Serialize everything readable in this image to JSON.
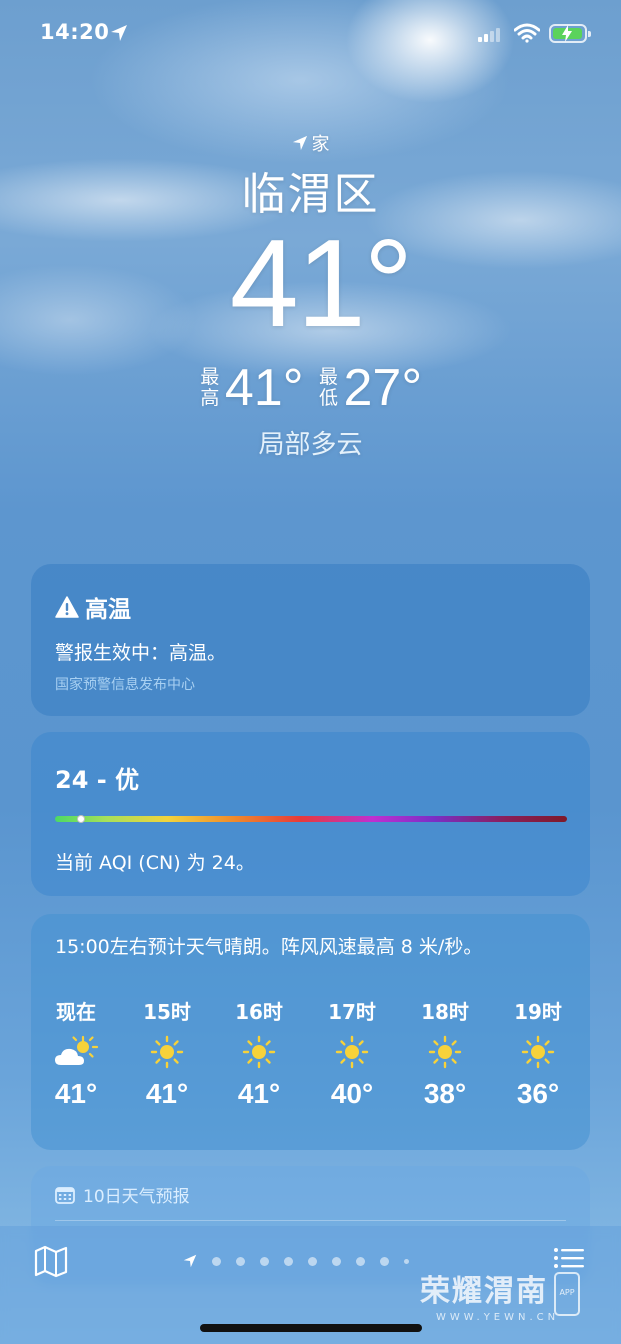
{
  "status_bar": {
    "time": "14:20"
  },
  "location": {
    "tag": "家",
    "city": "临渭区",
    "temperature": "41°",
    "high_label": "最高",
    "high": "41°",
    "low_label": "最低",
    "low": "27°",
    "condition": "局部多云"
  },
  "alert": {
    "title": "高温",
    "body": "警报生效中：高温。",
    "source": "国家预警信息发布中心"
  },
  "aqi": {
    "title": "24 - 优",
    "description": "当前 AQI (CN) 为 24。",
    "level_fraction": 0.05
  },
  "hourly": {
    "summary": "15:00左右预计天气晴朗。阵风风速最高 8 米/秒。",
    "items": [
      {
        "time": "现在",
        "icon": "partly-sunny-icon",
        "temp": "41°"
      },
      {
        "time": "15时",
        "icon": "sun-icon",
        "temp": "41°"
      },
      {
        "time": "16时",
        "icon": "sun-icon",
        "temp": "41°"
      },
      {
        "time": "17时",
        "icon": "sun-icon",
        "temp": "40°"
      },
      {
        "time": "18时",
        "icon": "sun-icon",
        "temp": "38°"
      },
      {
        "time": "19时",
        "icon": "sun-icon",
        "temp": "36°"
      }
    ]
  },
  "forecast": {
    "title": "10日天气预报"
  },
  "watermark": {
    "name": "荣耀渭南",
    "site": "WWW.YEWN.CN",
    "app": "APP"
  },
  "colors": {
    "aqi_good": "#4cd964",
    "sun": "#f7d23a"
  }
}
